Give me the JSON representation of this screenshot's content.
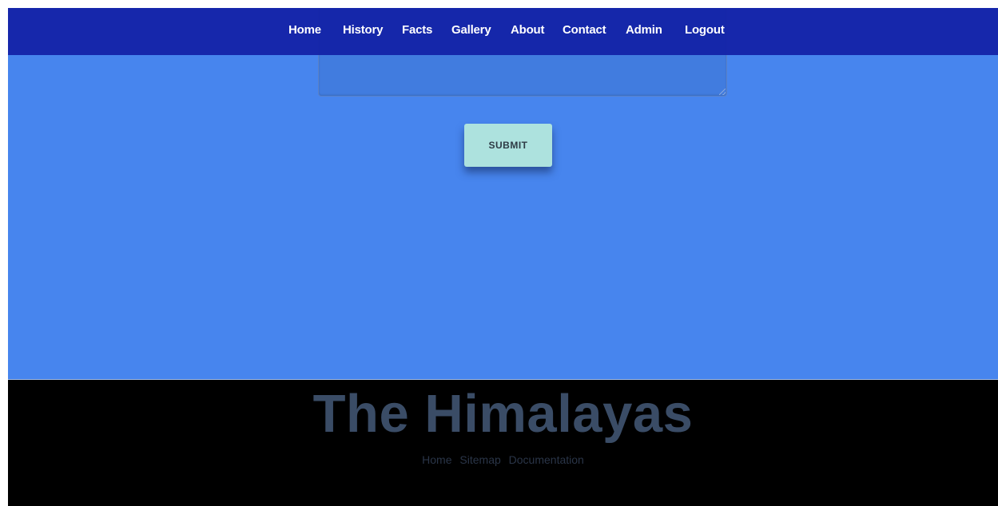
{
  "nav": {
    "items": [
      {
        "label": "Home"
      },
      {
        "label": "History"
      },
      {
        "label": "Facts"
      },
      {
        "label": "Gallery"
      },
      {
        "label": "About"
      },
      {
        "label": "Contact"
      },
      {
        "label": "Admin"
      },
      {
        "label": "Logout"
      }
    ]
  },
  "form": {
    "message_value": "",
    "submit_label": "SUBMIT"
  },
  "footer": {
    "title": "The Himalayas",
    "links": [
      {
        "label": "Home"
      },
      {
        "label": "Sitemap"
      },
      {
        "label": "Documentation"
      }
    ]
  },
  "colors": {
    "navbar": "#1423a8",
    "main_background": "#4785ee",
    "submit_button": "#ade2de",
    "footer_background": "#000000",
    "footer_title": "#3a4c66"
  }
}
